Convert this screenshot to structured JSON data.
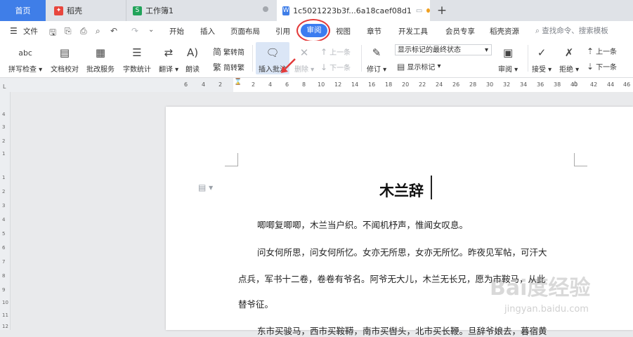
{
  "tabs": {
    "home": "首页",
    "daoke": "稻壳",
    "sheet": "工作簿1",
    "document": "1c5021223b3f...6a18caef08d1",
    "new_tab": "+"
  },
  "menu": {
    "file": "文件",
    "items": [
      "开始",
      "插入",
      "页面布局",
      "引用",
      "审阅",
      "视图",
      "章节",
      "开发工具",
      "会员专享",
      "稻壳资源"
    ],
    "active": "审阅",
    "search": "查找命令、搜索模板"
  },
  "toolbar": {
    "spell_check": "拼写检查",
    "doc_proof": "文档校对",
    "batch_service": "批改服务",
    "word_count": "字数统计",
    "translate": "翻译",
    "read_aloud": "朗读",
    "trad_to_simp": "繁转简",
    "simp_to_trad": "简转繁",
    "insert_comment": "插入批注",
    "delete": "删除",
    "prev": "上一条",
    "next": "下一条",
    "track_changes": "修订",
    "markup_state": "显示标记的最终状态",
    "show_markup": "显示标记",
    "review": "审阅",
    "accept": "接受",
    "reject": "拒绝",
    "prev2": "上一条",
    "next2": "下一条",
    "spell_icon_text": "abc"
  },
  "ruler": {
    "h_ticks": [
      "6",
      "4",
      "2",
      "2",
      "4",
      "6",
      "8",
      "10",
      "12",
      "14",
      "16",
      "18",
      "20",
      "22",
      "24",
      "26",
      "28",
      "30",
      "32",
      "34",
      "36",
      "38",
      "40",
      "42",
      "44",
      "46"
    ],
    "v_ticks": [
      "4",
      "3",
      "2",
      "1",
      "1",
      "2",
      "3",
      "4",
      "5",
      "6",
      "7",
      "8",
      "9",
      "10",
      "11",
      "12"
    ]
  },
  "document": {
    "title": "木兰辞",
    "paragraphs": [
      "唧唧复唧唧，木兰当户织。不闻机杼声，惟闻女叹息。",
      "问女何所思，问女何所忆。女亦无所思，女亦无所忆。昨夜见军帖，可汗大",
      "点兵，军书十二卷，卷卷有爷名。阿爷无大儿，木兰无长兄，愿为市鞍马，从此",
      "替爷征。",
      "东市买骏马，西市买鞍鞯，南市买辔头，北市买长鞭。旦辞爷娘去，暮宿黄"
    ]
  },
  "watermark": {
    "brand": "Bai度经验",
    "url": "jingyan.baidu.com"
  },
  "colors": {
    "accent": "#3b7cf0",
    "highlight_ring": "#e33a3a",
    "home_tab": "#3f7ee8"
  }
}
